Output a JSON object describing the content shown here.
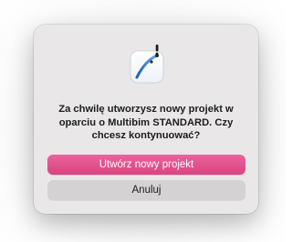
{
  "dialog": {
    "icon": "multibim-app-icon-with-alert",
    "message": "Za chwilę utworzysz nowy projekt w oparciu o Multibim STANDARD. Czy chcesz kontynuować?",
    "primary_button_label": "Utwórz nowy projekt",
    "secondary_button_label": "Anuluj"
  },
  "colors": {
    "primary_button": "#de4f88",
    "secondary_button": "#d4d2d2",
    "dialog_background": "#e9e7e7",
    "text": "#1d1d1f"
  }
}
